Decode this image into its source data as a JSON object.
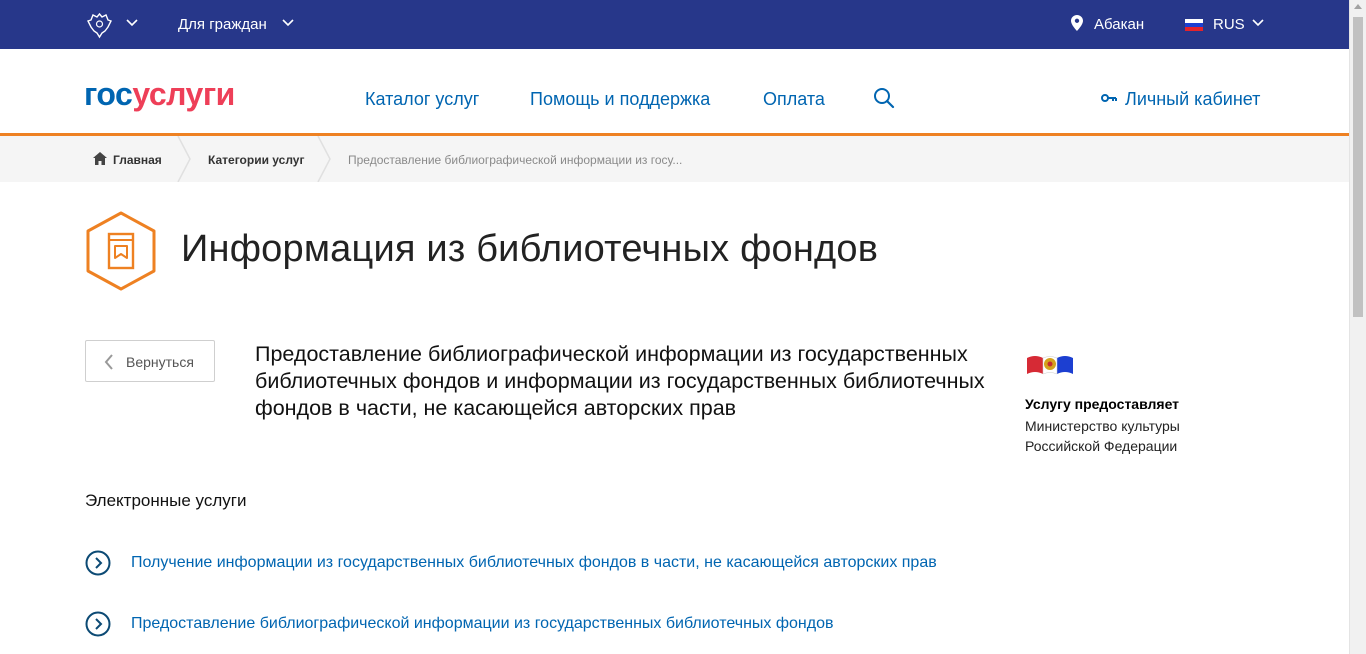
{
  "topbar": {
    "region": "Для граждан",
    "city": "Абакан",
    "language": "RUS"
  },
  "header": {
    "logo_part1": "гос",
    "logo_part2": "услуги",
    "nav": {
      "catalog": "Каталог услуг",
      "help": "Помощь и поддержка",
      "payment": "Оплата"
    },
    "cabinet": "Личный кабинет"
  },
  "breadcrumb": {
    "home": "Главная",
    "categories": "Категории услуг",
    "current": "Предоставление библиографической информации из госу..."
  },
  "page": {
    "title": "Информация из библиотечных фондов",
    "back_label": "Вернуться",
    "service_title": "Предоставление библиографической информации из государственных библиотечных фондов и информации из государственных библиотечных фондов в части, не касающейся авторских прав",
    "provider_label": "Услугу предоставляет",
    "provider_name": "Министерство культуры Российской Федерации",
    "section_title": "Электронные услуги",
    "services": [
      {
        "label": "Получение информации из государственных библиотечных фондов в части, не касающейся авторских прав"
      },
      {
        "label": "Предоставление библиографической информации из государственных библиотечных фондов"
      }
    ]
  },
  "colors": {
    "topbar_bg": "#27378a",
    "accent_orange": "#ee8122",
    "link_blue": "#0065b1",
    "logo_red": "#ee3f58"
  },
  "icons": [
    "emblem-icon",
    "chevron-down-icon",
    "location-pin-icon",
    "flag-ru-icon",
    "search-icon",
    "key-icon",
    "home-icon",
    "book-hex-icon",
    "chevron-left-icon",
    "arrow-circle-right-icon"
  ]
}
